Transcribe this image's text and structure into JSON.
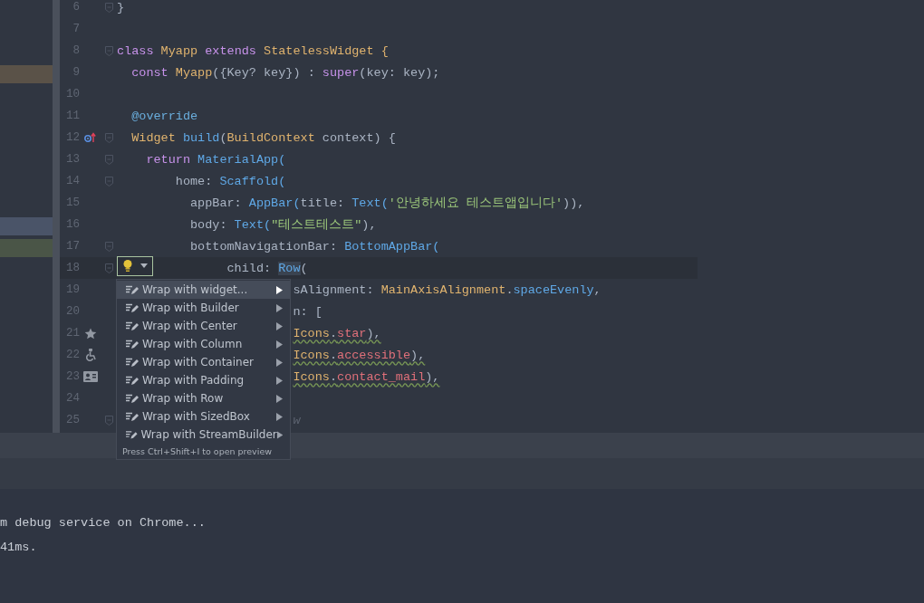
{
  "editor": {
    "lines": [
      {
        "number": "6",
        "fold": true,
        "tokens": [
          {
            "text": "}",
            "kind": "plain"
          }
        ]
      },
      {
        "number": "7",
        "fold": false
      },
      {
        "number": "8",
        "fold": true,
        "tokens": [
          {
            "text": "class",
            "kind": "keyword"
          },
          {
            "text": " Myapp",
            "kind": "type"
          },
          {
            "text": " extends",
            "kind": "keyword"
          },
          {
            "text": " StatelessWidget {",
            "kind": "type"
          }
        ],
        "children": [
          {
            "number": "9",
            "color": "#5a5248",
            "fold": false,
            "tokens": [
              {
                "text": "const",
                "kind": "keyword"
              },
              {
                "text": " Myapp",
                "kind": "type"
              },
              {
                "text": "({Key? key}) : ",
                "kind": "plain"
              },
              {
                "text": "super",
                "kind": "keyword"
              },
              {
                "text": "(key: key);",
                "kind": "plain"
              }
            ]
          },
          {
            "number": "10",
            "fold": false
          },
          {
            "number": "11",
            "fold": false,
            "tokens": [
              {
                "text": "@override",
                "kind": "annotation"
              }
            ]
          },
          {
            "number": "12",
            "fold": true,
            "marker": {
              "kind": "override"
            },
            "tokens": [
              {
                "text": "Widget",
                "kind": "type"
              },
              {
                "text": " build",
                "kind": "call"
              },
              {
                "text": "(",
                "kind": "plain"
              },
              {
                "text": "BuildContext",
                "kind": "type"
              },
              {
                "text": " context) {",
                "kind": "plain"
              }
            ],
            "children": [
              {
                "number": "13",
                "fold": true,
                "tokens": [
                  {
                    "text": "return",
                    "kind": "keyword"
                  },
                  {
                    "text": " MaterialApp(",
                    "kind": "call"
                  }
                ],
                "children": [
                  {
                    "number": "14",
                    "fold": true,
                    "tokens": [
                      {
                        "text": "home: ",
                        "kind": "plain"
                      },
                      {
                        "text": "Scaffold(",
                        "kind": "call"
                      }
                    ],
                    "children": [
                      {
                        "number": "15",
                        "fold": false,
                        "tokens": [
                          {
                            "text": "appBar: ",
                            "kind": "plain"
                          },
                          {
                            "text": "AppBar(",
                            "kind": "call"
                          },
                          {
                            "text": "title: ",
                            "kind": "plain"
                          },
                          {
                            "text": "Text(",
                            "kind": "call"
                          },
                          {
                            "text": "'안녕하세요 테스트앱입니다'",
                            "kind": "string"
                          },
                          {
                            "text": ")),",
                            "kind": "plain"
                          }
                        ]
                      },
                      {
                        "number": "16",
                        "color": "#4a5468",
                        "fold": false,
                        "tokens": [
                          {
                            "text": "body: ",
                            "kind": "plain"
                          },
                          {
                            "text": "Text(",
                            "kind": "call"
                          },
                          {
                            "text": "\"테스트테스트\"",
                            "kind": "string"
                          },
                          {
                            "text": "),",
                            "kind": "plain"
                          }
                        ]
                      },
                      {
                        "number": "17",
                        "color": "#4a5547",
                        "fold": true,
                        "tokens": [
                          {
                            "text": "bottomNavigationBar: ",
                            "kind": "plain"
                          },
                          {
                            "text": "BottomAppBar(",
                            "kind": "call"
                          }
                        ],
                        "children": [
                          {
                            "number": "18",
                            "fold": true,
                            "current": true,
                            "bulb": true,
                            "tokens": [
                              {
                                "text": "child: ",
                                "kind": "plain"
                              },
                              {
                                "text": "Row",
                                "kind": "call",
                                "highlight": true
                              },
                              {
                                "text": "(",
                                "kind": "plain"
                              }
                            ],
                            "children": [
                              {
                                "number": "19",
                                "fold": false,
                                "tokens": [
                                  {
                                    "text": "sAlignment: ",
                                    "kind": "plain"
                                  },
                                  {
                                    "text": "MainAxisAlignment",
                                    "kind": "type"
                                  },
                                  {
                                    "text": ".",
                                    "kind": "plain"
                                  },
                                  {
                                    "text": "spaceEvenly",
                                    "kind": "call"
                                  },
                                  {
                                    "text": ",",
                                    "kind": "plain"
                                  }
                                ]
                              },
                              {
                                "number": "20",
                                "fold": false,
                                "tokens": [
                                  {
                                    "text": "n: [",
                                    "kind": "plain"
                                  }
                                ]
                              },
                              {
                                "number": "21",
                                "fold": false,
                                "marker": {
                                  "kind": "star"
                                },
                                "tokens": [
                                  {
                                    "text": "Icons",
                                    "kind": "type",
                                    "warn": true
                                  },
                                  {
                                    "text": ".",
                                    "kind": "plain",
                                    "warn": true
                                  },
                                  {
                                    "text": "star",
                                    "kind": "member",
                                    "warn": true
                                  },
                                  {
                                    "text": "),",
                                    "kind": "plain",
                                    "warn": true
                                  }
                                ]
                              },
                              {
                                "number": "22",
                                "fold": false,
                                "marker": {
                                  "kind": "accessible"
                                },
                                "tokens": [
                                  {
                                    "text": "Icons",
                                    "kind": "type",
                                    "warn": true
                                  },
                                  {
                                    "text": ".",
                                    "kind": "plain",
                                    "warn": true
                                  },
                                  {
                                    "text": "accessible",
                                    "kind": "member",
                                    "warn": true
                                  },
                                  {
                                    "text": "),",
                                    "kind": "plain",
                                    "warn": true
                                  }
                                ]
                              },
                              {
                                "number": "23",
                                "fold": false,
                                "marker": {
                                  "kind": "contact"
                                },
                                "tokens": [
                                  {
                                    "text": "Icons",
                                    "kind": "type",
                                    "warn": true
                                  },
                                  {
                                    "text": ".",
                                    "kind": "plain",
                                    "warn": true
                                  },
                                  {
                                    "text": "contact_mail",
                                    "kind": "member",
                                    "warn": true
                                  },
                                  {
                                    "text": "),",
                                    "kind": "plain",
                                    "warn": true
                                  }
                                ]
                              },
                              {
                                "number": "24",
                                "fold": false
                              },
                              {
                                "number": "25",
                                "fold": true,
                                "tokens": [
                                  {
                                    "text": "w",
                                    "kind": "hint"
                                  }
                                ]
                              }
                            ]
                          }
                        ]
                      }
                    ]
                  }
                ]
              }
            ]
          }
        ]
      }
    ]
  },
  "intention_menu": {
    "items": [
      {
        "label": "Wrap with widget...",
        "selected": true
      },
      {
        "label": "Wrap with Builder",
        "selected": false
      },
      {
        "label": "Wrap with Center",
        "selected": false
      },
      {
        "label": "Wrap with Column",
        "selected": false
      },
      {
        "label": "Wrap with Container",
        "selected": false
      },
      {
        "label": "Wrap with Padding",
        "selected": false
      },
      {
        "label": "Wrap with Row",
        "selected": false
      },
      {
        "label": "Wrap with SizedBox",
        "selected": false
      },
      {
        "label": "Wrap with StreamBuilder",
        "selected": false
      }
    ],
    "hint": "Press Ctrl+Shift+I to open preview"
  },
  "console": {
    "lines": [
      "m debug service on Chrome...",
      "41ms."
    ]
  }
}
